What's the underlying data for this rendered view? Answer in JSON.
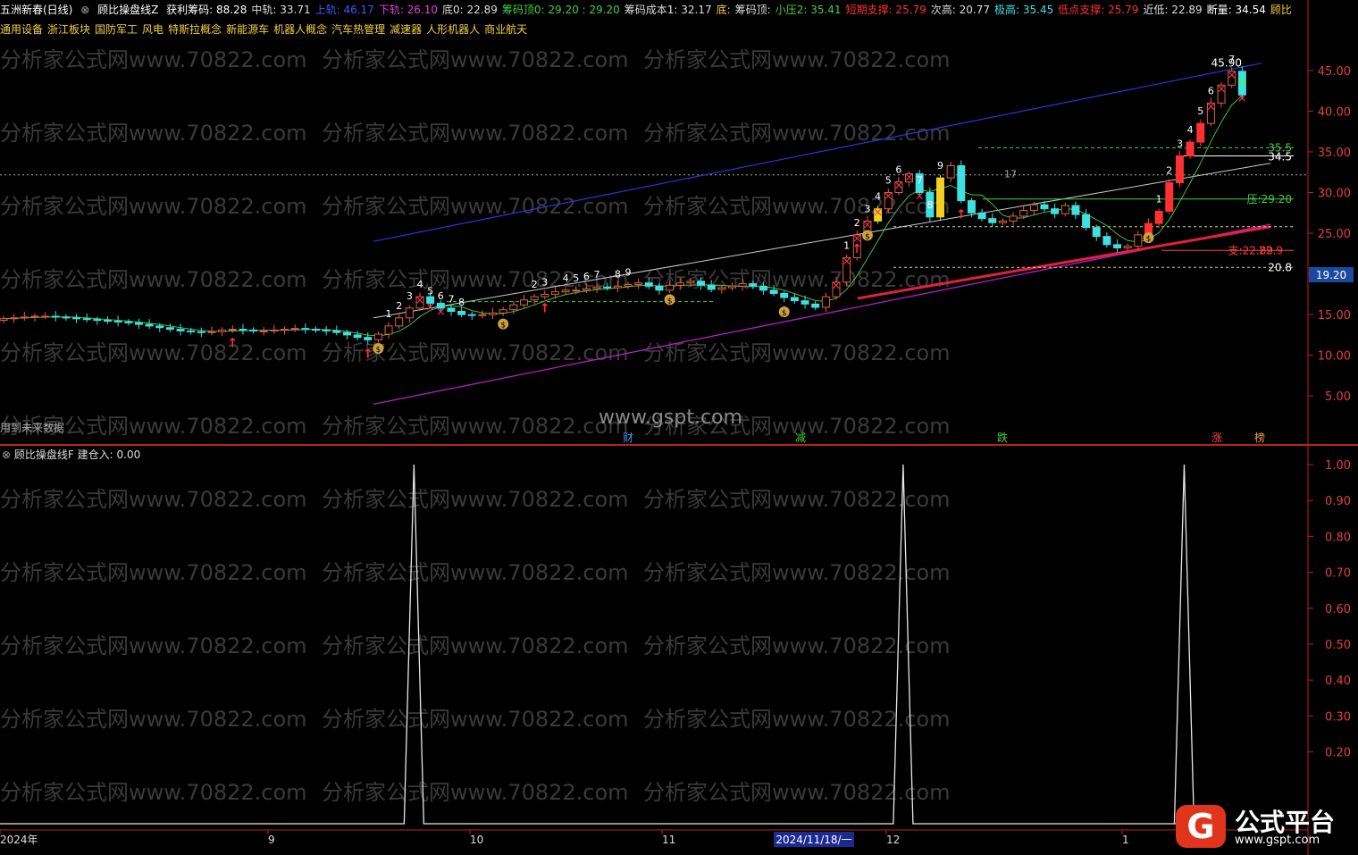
{
  "header": {
    "stock": "五洲新春(日线)",
    "indicator": "顾比操盘线Z",
    "items": [
      {
        "label": "获利筹码:",
        "value": "88.28",
        "color": "#ffffff"
      },
      {
        "label": "中轨:",
        "value": "33.71",
        "color": "#dddddd"
      },
      {
        "label": "上轨:",
        "value": "46.17",
        "color": "#3b5bff"
      },
      {
        "label": "下轨:",
        "value": "26.10",
        "color": "#e040e0"
      },
      {
        "label": "底0:",
        "value": "22.89",
        "color": "#dddddd"
      },
      {
        "label": "筹码顶0:",
        "value": "29.20 : 29.20",
        "color": "#40d040"
      },
      {
        "label": "筹码成本1:",
        "value": "32.17",
        "color": "#dddddd"
      },
      {
        "label": "底:",
        "value": "",
        "color": "#f0d040"
      },
      {
        "label": "筹码顶:",
        "value": "",
        "color": "#dddddd"
      },
      {
        "label": "小压2:",
        "value": "35.41",
        "color": "#40d040"
      },
      {
        "label": "短期支撑:",
        "value": "25.79",
        "color": "#ff3030"
      },
      {
        "label": "次高:",
        "value": "20.77",
        "color": "#dddddd"
      },
      {
        "label": "极高:",
        "value": "35.45",
        "color": "#40e0e0"
      },
      {
        "label": "低点支撑:",
        "value": "25.79",
        "color": "#ff3030"
      },
      {
        "label": "近低:",
        "value": "22.89",
        "color": "#dddddd"
      },
      {
        "label": "断量:",
        "value": "34.54",
        "color": "#ffffff"
      },
      {
        "label": "顾比",
        "value": "",
        "color": "#f0d040"
      }
    ]
  },
  "concepts": [
    "通用设备",
    "浙江板块",
    "国防军工",
    "风电",
    "特斯拉概念",
    "新能源车",
    "机器人概念",
    "汽车热管理",
    "减速器",
    "人形机器人",
    "商业航天"
  ],
  "watermark": {
    "text": "分析家公式网www.70822.com",
    "center": "www.gspt.com"
  },
  "future_note": "用到未来数据",
  "price_tag": "19.20",
  "levels": {
    "l355": "35.5",
    "l345": "34.5",
    "l2920": "压:29.20",
    "l229": "支:22.89",
    "l2299": "22.9",
    "l208": "20.8",
    "l4590": "45.90",
    "l17": "17"
  },
  "event_labels": [
    {
      "text": "财",
      "color": "#4a90ff",
      "pos": 703
    },
    {
      "text": "减",
      "color": "#40d040",
      "pos": 896
    },
    {
      "text": "跌",
      "color": "#40d040",
      "pos": 1122
    },
    {
      "text": "涨",
      "color": "#ff4040",
      "pos": 1362
    },
    {
      "text": "榜",
      "color": "#f0a040",
      "pos": 1410
    }
  ],
  "chart_data": [
    {
      "type": "candlestick",
      "title": "顾比操盘线Z",
      "x": [
        "2024年",
        "9",
        "10",
        "11",
        "12",
        "1"
      ],
      "ylim": [
        2.5,
        48.5
      ],
      "yticks": [
        "45.00",
        "40.00",
        "35.00",
        "30.00",
        "25.00",
        "20.00",
        "15.00",
        "10.00",
        "5.00"
      ],
      "close": [
        14.5,
        14.6,
        14.7,
        14.8,
        14.8,
        14.7,
        14.6,
        14.5,
        14.4,
        14.3,
        14.2,
        14.1,
        14.0,
        13.8,
        13.6,
        13.4,
        13.2,
        13.0,
        12.9,
        12.8,
        12.9,
        13.1,
        13.2,
        13.1,
        13.0,
        13.0,
        13.1,
        13.2,
        13.3,
        13.2,
        13.1,
        13.0,
        12.8,
        12.5,
        12.2,
        11.9,
        12.6,
        13.6,
        14.6,
        15.8,
        17.2,
        16.4,
        15.8,
        15.4,
        15.0,
        14.9,
        15.0,
        15.2,
        15.6,
        16.2,
        16.8,
        17.2,
        17.5,
        17.8,
        18.0,
        18.0,
        18.2,
        18.4,
        18.3,
        18.5,
        18.7,
        18.9,
        18.5,
        18.0,
        18.6,
        18.9,
        19.1,
        18.6,
        18.1,
        18.3,
        18.5,
        18.8,
        18.5,
        18.0,
        17.6,
        17.1,
        16.7,
        16.3,
        15.9,
        17.2,
        19.0,
        22.0,
        24.8,
        26.5,
        28.0,
        30.0,
        31.3,
        32.3,
        30.0,
        27.0,
        31.8,
        33.3,
        29.0,
        27.5,
        26.8,
        26.3,
        26.5,
        27.1,
        27.8,
        28.5,
        28.0,
        27.4,
        28.4,
        27.3,
        25.7,
        24.6,
        23.6,
        23.2,
        23.4,
        24.8,
        26.2,
        27.7,
        31.2,
        34.5,
        36.2,
        38.5,
        41.0,
        43.2,
        44.9,
        42.0
      ],
      "series": [
        {
          "name": "上轨",
          "values": [
            24.0,
            45.9
          ]
        },
        {
          "name": "下轨",
          "values": [
            4.0,
            26.1
          ]
        },
        {
          "name": "中轨",
          "values": [
            14.6,
            33.6
          ]
        }
      ]
    },
    {
      "type": "line",
      "title": "顾比操盘线F",
      "series": [
        {
          "name": "建仓入",
          "current": 0.0,
          "spikes_at_bars": [
            39,
            86,
            113
          ]
        }
      ],
      "ylim": [
        0,
        1.0
      ],
      "yticks": [
        "1.00",
        "0.90",
        "0.80",
        "0.70",
        "0.60",
        "0.50",
        "0.40",
        "0.30",
        "0.20"
      ]
    }
  ],
  "date_tag": "2024/11/18/一",
  "logo": {
    "badge": "G",
    "title": "公式平台",
    "url": "www.gspt.com"
  }
}
